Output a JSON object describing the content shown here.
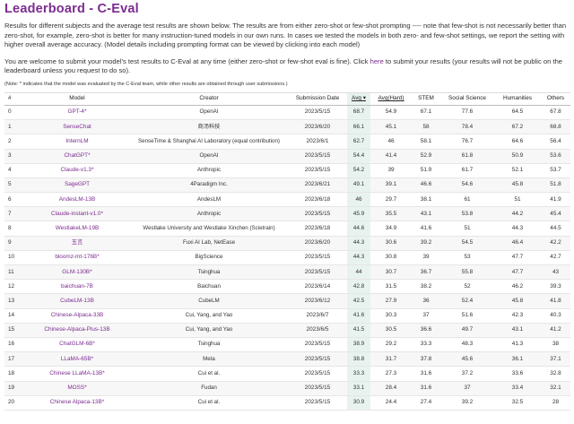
{
  "title": "Leaderboard - C-Eval",
  "description": "Results for different subjects and the average test results are shown below. The results are from either zero-shot or few-shot prompting ---- note that few-shot is not necessarily better than zero-shot, for example, zero-shot is better for many instruction-tuned models in our own runs. In cases we tested the models in both zero- and few-shot settings, we report the setting with higher overall average accuracy. (Model details including prompting format can be viewed by clicking into each model)",
  "submit": {
    "before": "You are welcome to submit your model's test results to C-Eval at any time (either zero-shot or few-shot eval is fine). Click ",
    "link": "here",
    "after": " to submit your results (your results will not be public on the leaderboard unless you request to do so)."
  },
  "note": "(Note: * indicates that the model was evaluated by the C-Eval team, while other results are obtained through user submissions.)",
  "table": {
    "headers": {
      "idx": "#",
      "model": "Model",
      "creator": "Creator",
      "date": "Submission Date",
      "avg": "Avg ▾",
      "avg_hard": "Avg(Hard)",
      "stem": "STEM",
      "social": "Social Science",
      "humanities": "Humanities",
      "others": "Others"
    },
    "rows": [
      {
        "idx": "0",
        "model": "GPT-4*",
        "creator": "OpenAI",
        "date": "2023/5/15",
        "avg": "68.7",
        "avg_hard": "54.9",
        "stem": "67.1",
        "social": "77.6",
        "humanities": "64.5",
        "others": "67.8"
      },
      {
        "idx": "1",
        "model": "SenseChat",
        "creator": "商汤科技",
        "date": "2023/6/20",
        "avg": "66.1",
        "avg_hard": "45.1",
        "stem": "58",
        "social": "78.4",
        "humanities": "67.2",
        "others": "68.8"
      },
      {
        "idx": "2",
        "model": "InternLM",
        "creator": "SenseTime & Shanghai AI Laboratory (equal contribution)",
        "date": "2023/6/1",
        "avg": "62.7",
        "avg_hard": "46",
        "stem": "58.1",
        "social": "76.7",
        "humanities": "64.6",
        "others": "56.4"
      },
      {
        "idx": "3",
        "model": "ChatGPT*",
        "creator": "OpenAI",
        "date": "2023/5/15",
        "avg": "54.4",
        "avg_hard": "41.4",
        "stem": "52.9",
        "social": "61.8",
        "humanities": "50.9",
        "others": "53.6"
      },
      {
        "idx": "4",
        "model": "Claude-v1.3*",
        "creator": "Anthropic",
        "date": "2023/5/15",
        "avg": "54.2",
        "avg_hard": "39",
        "stem": "51.9",
        "social": "61.7",
        "humanities": "52.1",
        "others": "53.7"
      },
      {
        "idx": "5",
        "model": "SageGPT",
        "creator": "4Paradigm Inc.",
        "date": "2023/6/21",
        "avg": "49.1",
        "avg_hard": "39.1",
        "stem": "46.6",
        "social": "54.6",
        "humanities": "45.8",
        "others": "51.8"
      },
      {
        "idx": "6",
        "model": "AndesLM-13B",
        "creator": "AndesLM",
        "date": "2023/6/18",
        "avg": "46",
        "avg_hard": "29.7",
        "stem": "38.1",
        "social": "61",
        "humanities": "51",
        "others": "41.9"
      },
      {
        "idx": "7",
        "model": "Claude-instant-v1.0*",
        "creator": "Anthropic",
        "date": "2023/5/15",
        "avg": "45.9",
        "avg_hard": "35.5",
        "stem": "43.1",
        "social": "53.8",
        "humanities": "44.2",
        "others": "45.4"
      },
      {
        "idx": "8",
        "model": "WestlakeLM-19B",
        "creator": "Westlake University and Westlake Xinchen (Scietrain)",
        "date": "2023/6/18",
        "avg": "44.6",
        "avg_hard": "34.9",
        "stem": "41.6",
        "social": "51",
        "humanities": "44.3",
        "others": "44.5"
      },
      {
        "idx": "9",
        "model": "玉言",
        "creator": "Fuxi AI Lab, NetEase",
        "date": "2023/6/20",
        "avg": "44.3",
        "avg_hard": "30.6",
        "stem": "39.2",
        "social": "54.5",
        "humanities": "46.4",
        "others": "42.2"
      },
      {
        "idx": "10",
        "model": "bloomz-mt-176B*",
        "creator": "BigScience",
        "date": "2023/5/15",
        "avg": "44.3",
        "avg_hard": "30.8",
        "stem": "39",
        "social": "53",
        "humanities": "47.7",
        "others": "42.7"
      },
      {
        "idx": "11",
        "model": "GLM-130B*",
        "creator": "Tsinghua",
        "date": "2023/5/15",
        "avg": "44",
        "avg_hard": "30.7",
        "stem": "36.7",
        "social": "55.8",
        "humanities": "47.7",
        "others": "43"
      },
      {
        "idx": "12",
        "model": "baichuan-7B",
        "creator": "Baichuan",
        "date": "2023/6/14",
        "avg": "42.8",
        "avg_hard": "31.5",
        "stem": "38.2",
        "social": "52",
        "humanities": "46.2",
        "others": "39.3"
      },
      {
        "idx": "13",
        "model": "CubeLM-13B",
        "creator": "CubeLM",
        "date": "2023/6/12",
        "avg": "42.5",
        "avg_hard": "27.9",
        "stem": "36",
        "social": "52.4",
        "humanities": "45.8",
        "others": "41.8"
      },
      {
        "idx": "14",
        "model": "Chinese-Alpaca-33B",
        "creator": "Cui, Yang, and Yao",
        "date": "2023/6/7",
        "avg": "41.6",
        "avg_hard": "30.3",
        "stem": "37",
        "social": "51.6",
        "humanities": "42.3",
        "others": "40.3"
      },
      {
        "idx": "15",
        "model": "Chinese-Alpaca-Plus-13B",
        "creator": "Cui, Yang, and Yao",
        "date": "2023/6/5",
        "avg": "41.5",
        "avg_hard": "30.5",
        "stem": "36.6",
        "social": "49.7",
        "humanities": "43.1",
        "others": "41.2"
      },
      {
        "idx": "16",
        "model": "ChatGLM-6B*",
        "creator": "Tsinghua",
        "date": "2023/5/15",
        "avg": "38.9",
        "avg_hard": "29.2",
        "stem": "33.3",
        "social": "48.3",
        "humanities": "41.3",
        "others": "38"
      },
      {
        "idx": "17",
        "model": "LLaMA-65B*",
        "creator": "Meta",
        "date": "2023/5/15",
        "avg": "38.8",
        "avg_hard": "31.7",
        "stem": "37.8",
        "social": "45.6",
        "humanities": "36.1",
        "others": "37.1"
      },
      {
        "idx": "18",
        "model": "Chinese LLaMA-13B*",
        "creator": "Cui et al.",
        "date": "2023/5/15",
        "avg": "33.3",
        "avg_hard": "27.3",
        "stem": "31.6",
        "social": "37.2",
        "humanities": "33.6",
        "others": "32.8"
      },
      {
        "idx": "19",
        "model": "MOSS*",
        "creator": "Fudan",
        "date": "2023/5/15",
        "avg": "33.1",
        "avg_hard": "28.4",
        "stem": "31.6",
        "social": "37",
        "humanities": "33.4",
        "others": "32.1"
      },
      {
        "idx": "20",
        "model": "Chinese Alpaca-13B*",
        "creator": "Cui et al.",
        "date": "2023/5/15",
        "avg": "30.9",
        "avg_hard": "24.4",
        "stem": "27.4",
        "social": "39.2",
        "humanities": "32.5",
        "others": "28"
      }
    ]
  }
}
